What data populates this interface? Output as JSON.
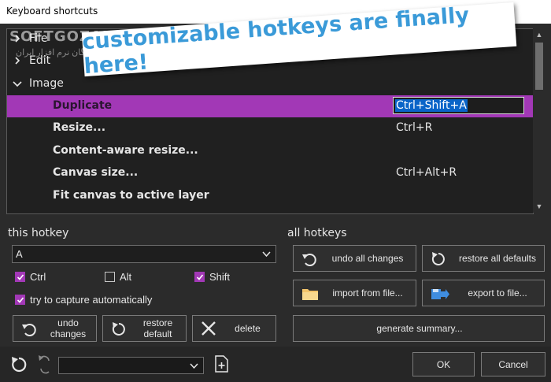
{
  "window": {
    "title": "Keyboard shortcuts"
  },
  "categories": [
    {
      "label": "File",
      "expanded": false
    },
    {
      "label": "Edit",
      "expanded": false
    },
    {
      "label": "Image",
      "expanded": true
    }
  ],
  "commands": [
    {
      "label": "Duplicate",
      "shortcut": "Ctrl+Shift+A",
      "selected": true
    },
    {
      "label": "Resize...",
      "shortcut": "Ctrl+R"
    },
    {
      "label": "Content-aware resize...",
      "shortcut": ""
    },
    {
      "label": "Canvas size...",
      "shortcut": "Ctrl+Alt+R"
    },
    {
      "label": "Fit canvas to active layer",
      "shortcut": ""
    }
  ],
  "banner": {
    "text": "customizable hotkeys are finally here!"
  },
  "watermark": {
    "text": "SOFTGOZAR.COM",
    "subtext": "دانلود رایگان نرم افزار ایران"
  },
  "this_hotkey": {
    "label": "this hotkey",
    "key_value": "A",
    "ctrl_label": "Ctrl",
    "ctrl_checked": true,
    "alt_label": "Alt",
    "alt_checked": false,
    "shift_label": "Shift",
    "shift_checked": true,
    "capture_label": "try to capture automatically",
    "capture_checked": true,
    "undo_label": "undo\nchanges",
    "restore_label": "restore\ndefault",
    "delete_label": "delete"
  },
  "all_hotkeys": {
    "label": "all hotkeys",
    "undo_all_label": "undo all changes",
    "restore_all_label": "restore all defaults",
    "import_label": "import from file...",
    "export_label": "export to file...",
    "summary_label": "generate summary..."
  },
  "footer": {
    "preset_value": "",
    "ok_label": "OK",
    "cancel_label": "Cancel"
  },
  "colors": {
    "accent": "#a238b6",
    "selection": "#0a64c8",
    "panel_bg": "#202020",
    "window_bg": "#2b2b2b",
    "banner_text": "#3a9ad8",
    "folder_icon": "#f2c46b",
    "export_icon": "#3f8de0"
  }
}
